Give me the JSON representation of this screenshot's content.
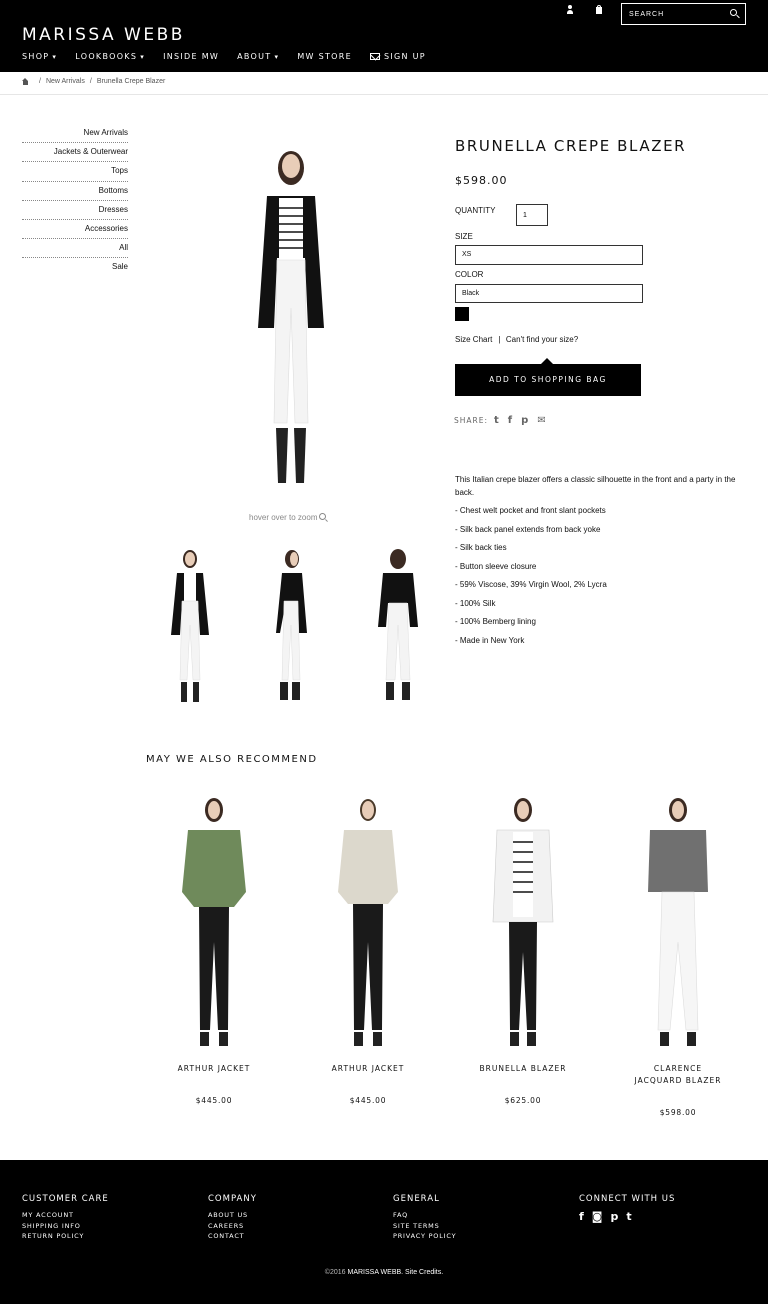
{
  "header": {
    "logo": "MARISSA WEBB",
    "search_placeholder": "SEARCH",
    "nav": [
      {
        "label": "SHOP",
        "has_caret": true
      },
      {
        "label": "LOOKBOOKS",
        "has_caret": true
      },
      {
        "label": "INSIDE MW",
        "has_caret": false
      },
      {
        "label": "ABOUT",
        "has_caret": true
      },
      {
        "label": "MW STORE",
        "has_caret": false
      },
      {
        "label": "SIGN UP",
        "has_caret": false
      }
    ],
    "caret": "▾"
  },
  "breadcrumb": {
    "sep": "/",
    "items": [
      "New Arrivals",
      "Brunella Crepe Blazer"
    ]
  },
  "sidebar": {
    "items": [
      "New Arrivals",
      "Jackets & Outerwear",
      "Tops",
      "Bottoms",
      "Dresses",
      "Accessories",
      "All",
      "Sale"
    ]
  },
  "gallery": {
    "zoom_hint": "hover over to zoom"
  },
  "product": {
    "title": "BRUNELLA CREPE BLAZER",
    "price": "$598.00",
    "quantity_label": "QUANTITY",
    "quantity_value": "1",
    "size_label": "SIZE",
    "size_value": "XS",
    "color_label": "COLOR",
    "color_value": "Black",
    "swatch_color": "#000000",
    "size_chart": "Size Chart",
    "size_divider": "|",
    "cant_find": "Can't find your size?",
    "add_to_bag": "ADD TO SHOPPING BAG",
    "share_label": "SHARE:",
    "share_icons": [
      "twitter-icon",
      "facebook-icon",
      "pinterest-icon",
      "email-icon"
    ],
    "share_glyphs": [
      "t",
      "f",
      "p",
      "✉"
    ],
    "description": "This Italian crepe blazer offers a classic silhouette in the front and a party in the back.",
    "bullets": [
      "- Chest welt pocket and front slant pockets",
      "- Silk back panel extends from back yoke",
      "- Silk back ties",
      "- Button sleeve closure",
      "- 59% Viscose, 39% Virgin Wool, 2% Lycra",
      "- 100% Silk",
      "- 100% Bemberg lining",
      "- Made in New York"
    ]
  },
  "recommend": {
    "title": "MAY WE ALSO RECOMMEND",
    "items": [
      {
        "name": "ARTHUR JACKET",
        "price": "$445.00",
        "jacket_color": "#6f8a5b"
      },
      {
        "name": "ARTHUR JACKET",
        "price": "$445.00",
        "jacket_color": "#dcd8cc"
      },
      {
        "name": "BRUNELLA BLAZER",
        "price": "$625.00",
        "jacket_color": "#f2f2f2"
      },
      {
        "name": "CLARENCE JACQUARD BLAZER",
        "price": "$598.00",
        "jacket_color": "#707070"
      }
    ]
  },
  "footer": {
    "columns": [
      {
        "heading": "CUSTOMER CARE",
        "links": [
          "MY ACCOUNT",
          "SHIPPING INFO",
          "RETURN POLICY"
        ]
      },
      {
        "heading": "COMPANY",
        "links": [
          "ABOUT US",
          "CAREERS",
          "CONTACT"
        ]
      },
      {
        "heading": "GENERAL",
        "links": [
          "FAQ",
          "SITE TERMS",
          "PRIVACY POLICY"
        ]
      }
    ],
    "connect_heading": "CONNECT WITH US",
    "social_glyphs": [
      "f",
      "◙",
      "p",
      "t"
    ],
    "copyright_prefix": "©2016",
    "copyright_brand": "MARISSA WEBB. Site Credits."
  },
  "colors": {
    "header_bg": "#000000",
    "footer_bg": "#000000",
    "button_bg": "#000000",
    "text": "#111111"
  }
}
